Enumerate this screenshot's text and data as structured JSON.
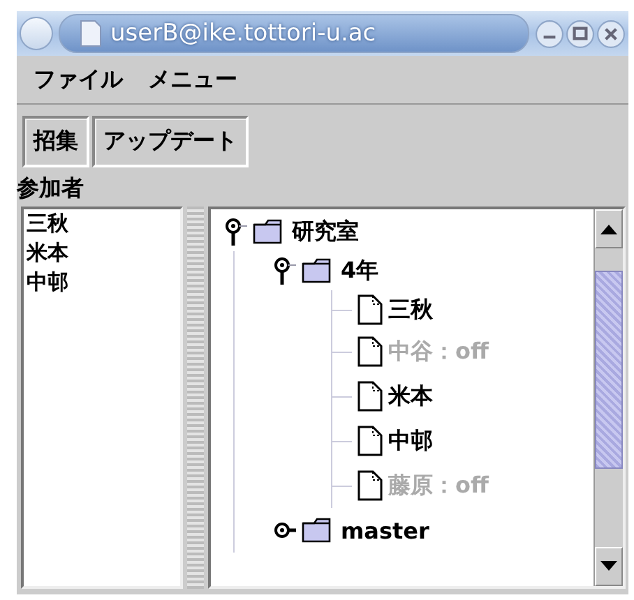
{
  "window": {
    "title": "userB@ike.tottori-u.ac"
  },
  "menu": [
    "ファイル",
    "メニュー"
  ],
  "toolbar": [
    "招集",
    "アップデート"
  ],
  "participants": {
    "label": "参加者",
    "items": [
      "三秋",
      "米本",
      "中邨"
    ]
  },
  "tree": [
    {
      "label": "研究室",
      "kind": "folder",
      "expanded": true,
      "children": [
        {
          "label": "4年",
          "kind": "folder",
          "expanded": true,
          "children": [
            {
              "label": "三秋",
              "kind": "leaf",
              "disabled": false
            },
            {
              "label": "中谷：off",
              "kind": "leaf",
              "disabled": true
            },
            {
              "label": "米本",
              "kind": "leaf",
              "disabled": false
            },
            {
              "label": "中邨",
              "kind": "leaf",
              "disabled": false
            },
            {
              "label": "藤原：off",
              "kind": "leaf",
              "disabled": true
            }
          ]
        },
        {
          "label": "master",
          "kind": "folder",
          "expanded": false
        }
      ]
    }
  ]
}
